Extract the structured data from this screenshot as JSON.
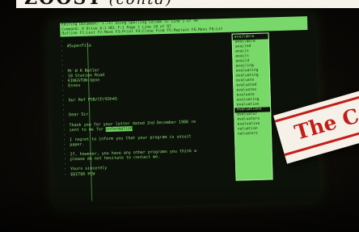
{
  "headline": {
    "main": "ZOOST",
    "sub": "(contd)"
  },
  "status_bar": {
    "rows": [
      "Editing Document: 1.TXT   Using Spelling  Column 57  Line 1 of 49",
      "Command: 0   Drive  A:1   HEL  F:1   Page 1  Line 10 of 97",
      "Outline  F1:Lost  F2:Move  F3:Print  F4:Close  Find  F5:Replace  F6:Menu  F6:Lst"
    ]
  },
  "document": {
    "lines": [
      {
        "text": "",
        "hl": ""
      },
      {
        "text": "#SuperFile",
        "hl": ""
      },
      {
        "text": "",
        "hl": ""
      },
      {
        "text": "",
        "hl": ""
      },
      {
        "text": "",
        "hl": ""
      },
      {
        "text": "",
        "hl": ""
      },
      {
        "text": "Mr W R Butler",
        "hl": ""
      },
      {
        "text": "10 Station Road",
        "hl": ""
      },
      {
        "text": "KINGSTON-Upon",
        "hl": ""
      },
      {
        "text": "Essex",
        "hl": ""
      },
      {
        "text": "",
        "hl": ""
      },
      {
        "text": "",
        "hl": ""
      },
      {
        "text": "Our Ref PSB/CP/93h4S",
        "hl": ""
      },
      {
        "text": "",
        "hl": ""
      },
      {
        "text": "",
        "hl": ""
      },
      {
        "text": "Dear Sir",
        "hl": ""
      },
      {
        "text": "",
        "hl": ""
      },
      {
        "text": "Thank you for your letter dated 2nd December 1986 re",
        "hl": ""
      },
      {
        "text": "sent to me for ",
        "hl": "information"
      },
      {
        "text": "",
        "hl": ""
      },
      {
        "text": "I regret to inform you that your program is unsuit",
        "hl": ""
      },
      {
        "text": "paper.",
        "hl": ""
      },
      {
        "text": "",
        "hl": ""
      },
      {
        "text": "If, however, you have any other programs you think w",
        "hl": ""
      },
      {
        "text": "please do not hesitate to contact me.",
        "hl": ""
      },
      {
        "text": "",
        "hl": ""
      },
      {
        "text": "Yours sincerely",
        "hl": ""
      },
      {
        "text": "EDITOR PCW",
        "hl": ""
      }
    ]
  },
  "dropdown": {
    "header": "available",
    "options": [
      "available",
      "availed",
      "avails",
      "avails",
      "availd",
      "availing",
      "evaluating",
      "evaluating",
      "evaluate",
      "evaluated",
      "evaluates",
      "evaluate",
      "evaluating",
      "evaluation",
      "evaluations",
      "evaluator",
      "evaluators",
      "evaluative",
      "valuation",
      "valuators"
    ],
    "selected_index": 14
  },
  "label_card": {
    "text": "The C"
  }
}
